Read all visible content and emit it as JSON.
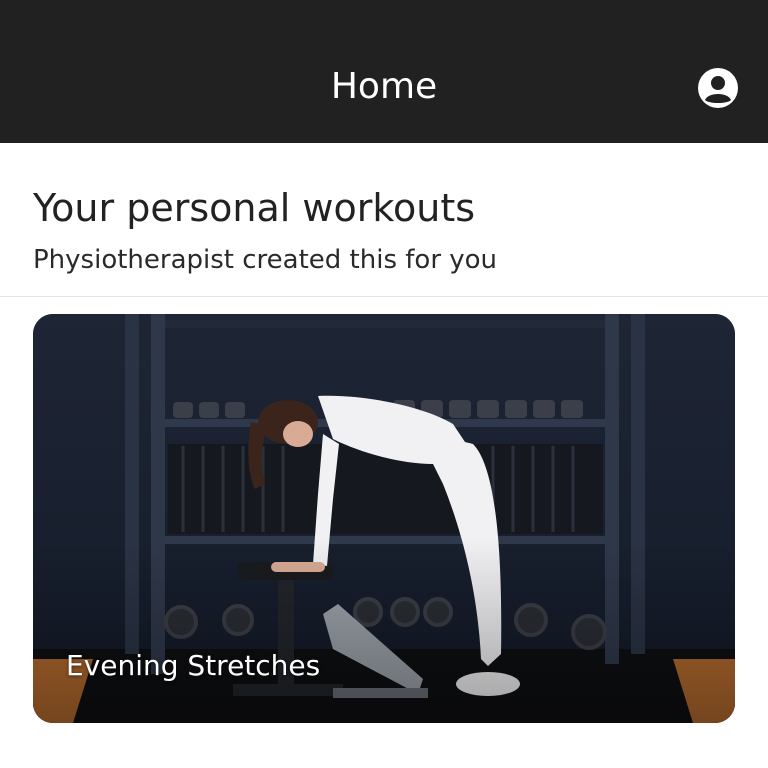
{
  "appbar": {
    "title": "Home",
    "account_icon": "account-circle-icon",
    "background": "#212121"
  },
  "section": {
    "title": "Your personal workouts",
    "subtitle": "Physiotherapist created this for you"
  },
  "workouts": [
    {
      "title": "Evening Stretches",
      "image": "woman-stretching-on-bench-in-gym"
    }
  ]
}
